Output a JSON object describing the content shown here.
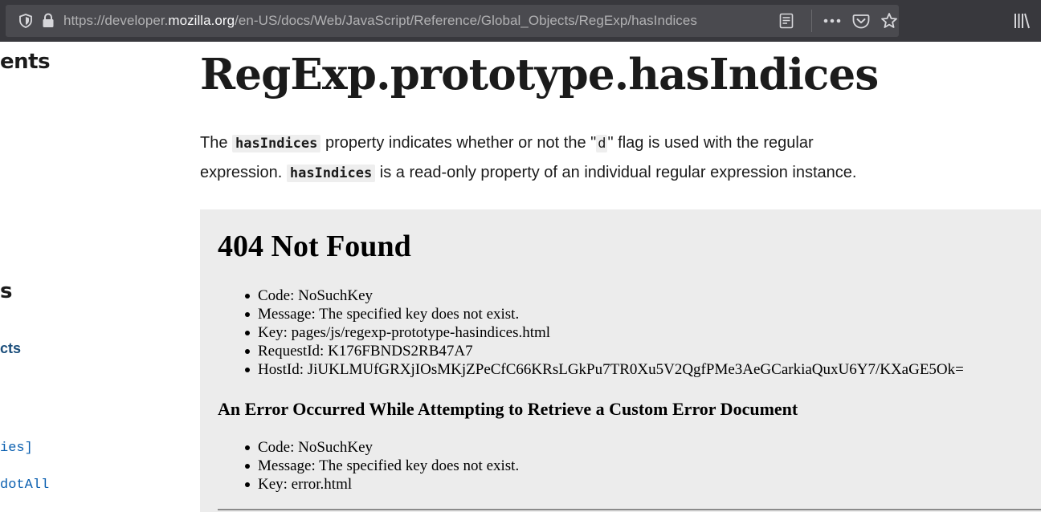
{
  "browser": {
    "url_prefix": "https://developer.",
    "url_host": "mozilla.org",
    "url_path": "/en-US/docs/Web/JavaScript/Reference/Global_Objects/RegExp/hasIndices"
  },
  "sidebar": {
    "heading_1": "ents",
    "heading_2": "s",
    "link_1": "cts",
    "link_2": "ies]",
    "link_3": "dotAll"
  },
  "article": {
    "title": "RegExp.prototype.hasIndices",
    "intro": {
      "t1": "The ",
      "c1": "hasIndices",
      "t2": " property indicates whether or not the \"",
      "c2": "d",
      "t3": "\" flag is used with the regular expression. ",
      "c3": "hasIndices",
      "t4": " is a read-only property of an individual regular expression instance."
    }
  },
  "error_page": {
    "title": "404 Not Found",
    "details": [
      "Code: NoSuchKey",
      "Message: The specified key does not exist.",
      "Key: pages/js/regexp-prototype-hasindices.html",
      "RequestId: K176FBNDS2RB47A7",
      "HostId: JiUKLMUfGRXjIOsMKjZPeCfC66KRsLGkPu7TR0Xu5V2QgfPMe3AeGCarkiaQuxU6Y7/KXaGE5Ok="
    ],
    "subtitle": "An Error Occurred While Attempting to Retrieve a Custom Error Document",
    "sub_details": [
      "Code: NoSuchKey",
      "Message: The specified key does not exist.",
      "Key: error.html"
    ]
  }
}
